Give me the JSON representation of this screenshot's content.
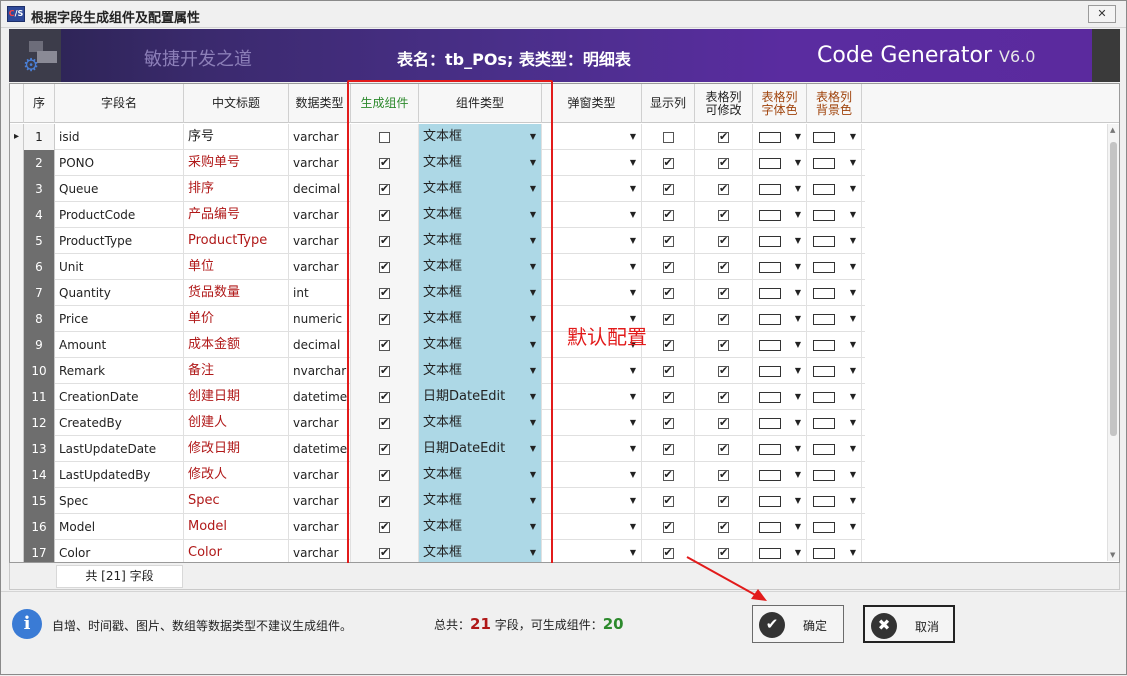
{
  "window": {
    "title": "根据字段生成组件及配置属性",
    "icon_text_a": "C",
    "icon_text_b": "S",
    "close": "✕"
  },
  "banner": {
    "slogan": "敏捷开发之道",
    "table_info": "表名：tb_POs;  表类型：明细表",
    "product": "Code Generator",
    "version": "V6.0"
  },
  "grid": {
    "headers": {
      "seq": "序",
      "field": "字段名",
      "caption": "中文标题",
      "dtype": "数据类型",
      "gen": "生成组件",
      "ctype": "组件类型",
      "popup": "弹窗类型",
      "show": "显示列",
      "editable_1": "表格列",
      "editable_2": "可修改",
      "fcolor_1": "表格列",
      "fcolor_2": "字体色",
      "bcolor_1": "表格列",
      "bcolor_2": "背景色"
    },
    "rows": [
      {
        "n": "1",
        "field": "isid",
        "caption": "序号",
        "dtype": "varchar",
        "gen": false,
        "ctype": "文本框",
        "show": false,
        "edit": true
      },
      {
        "n": "2",
        "field": "PONO",
        "caption": "采购单号",
        "dtype": "varchar",
        "gen": true,
        "ctype": "文本框",
        "show": true,
        "edit": true
      },
      {
        "n": "3",
        "field": "Queue",
        "caption": "排序",
        "dtype": "decimal",
        "gen": true,
        "ctype": "文本框",
        "show": true,
        "edit": true
      },
      {
        "n": "4",
        "field": "ProductCode",
        "caption": "产品编号",
        "dtype": "varchar",
        "gen": true,
        "ctype": "文本框",
        "show": true,
        "edit": true
      },
      {
        "n": "5",
        "field": "ProductType",
        "caption": "ProductType",
        "dtype": "varchar",
        "gen": true,
        "ctype": "文本框",
        "show": true,
        "edit": true
      },
      {
        "n": "6",
        "field": "Unit",
        "caption": "单位",
        "dtype": "varchar",
        "gen": true,
        "ctype": "文本框",
        "show": true,
        "edit": true
      },
      {
        "n": "7",
        "field": "Quantity",
        "caption": "货品数量",
        "dtype": "int",
        "gen": true,
        "ctype": "文本框",
        "show": true,
        "edit": true
      },
      {
        "n": "8",
        "field": "Price",
        "caption": "单价",
        "dtype": "numeric",
        "gen": true,
        "ctype": "文本框",
        "show": true,
        "edit": true
      },
      {
        "n": "9",
        "field": "Amount",
        "caption": "成本金额",
        "dtype": "decimal",
        "gen": true,
        "ctype": "文本框",
        "show": true,
        "edit": true
      },
      {
        "n": "10",
        "field": "Remark",
        "caption": "备注",
        "dtype": "nvarchar",
        "gen": true,
        "ctype": "文本框",
        "show": true,
        "edit": true
      },
      {
        "n": "11",
        "field": "CreationDate",
        "caption": "创建日期",
        "dtype": "datetime",
        "gen": true,
        "ctype": "日期DateEdit",
        "show": true,
        "edit": true
      },
      {
        "n": "12",
        "field": "CreatedBy",
        "caption": "创建人",
        "dtype": "varchar",
        "gen": true,
        "ctype": "文本框",
        "show": true,
        "edit": true
      },
      {
        "n": "13",
        "field": "LastUpdateDate",
        "caption": "修改日期",
        "dtype": "datetime",
        "gen": true,
        "ctype": "日期DateEdit",
        "show": true,
        "edit": true
      },
      {
        "n": "14",
        "field": "LastUpdatedBy",
        "caption": "修改人",
        "dtype": "varchar",
        "gen": true,
        "ctype": "文本框",
        "show": true,
        "edit": true
      },
      {
        "n": "15",
        "field": "Spec",
        "caption": "Spec",
        "dtype": "varchar",
        "gen": true,
        "ctype": "文本框",
        "show": true,
        "edit": true
      },
      {
        "n": "16",
        "field": "Model",
        "caption": "Model",
        "dtype": "varchar",
        "gen": true,
        "ctype": "文本框",
        "show": true,
        "edit": true
      },
      {
        "n": "17",
        "field": "Color",
        "caption": "Color",
        "dtype": "varchar",
        "gen": true,
        "ctype": "文本框",
        "show": true,
        "edit": true
      }
    ],
    "footer_count": "共 [21] 字段",
    "annotation": "默认配置"
  },
  "bottom": {
    "tip": "自增、时间戳、图片、数组等数据类型不建议生成组件。",
    "summary_prefix": "总共：",
    "total": "21",
    "summary_mid": " 字段，可生成组件：",
    "generatable": "20",
    "ok_label": "确定",
    "cancel_label": "取消"
  },
  "colors": {
    "accent_red": "#e21b1b",
    "type_cell": "#add8e6",
    "banner": "#4a2f8a"
  },
  "icons": [
    "app-icon",
    "close-icon",
    "gear-icon",
    "info-icon",
    "check-circle-icon",
    "x-circle-icon",
    "dropdown-arrow-icon",
    "row-indicator-icon"
  ]
}
